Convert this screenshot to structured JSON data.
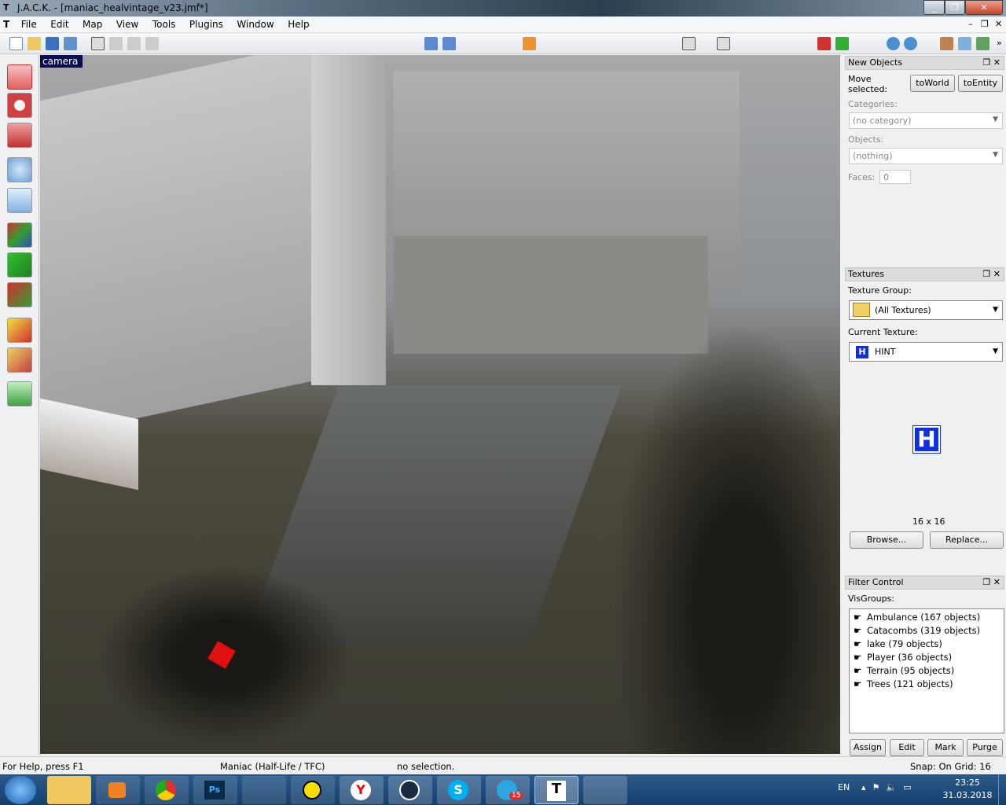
{
  "window": {
    "title": "J.A.C.K. - [maniac_healvintage_v23.jmf*]",
    "buttons": [
      "minimize",
      "maximize",
      "close"
    ]
  },
  "menu": [
    "File",
    "Edit",
    "Map",
    "View",
    "Tools",
    "Plugins",
    "Window",
    "Help"
  ],
  "viewport": {
    "label": "camera"
  },
  "left_tools": [
    "selection-tool",
    "magnify-tool",
    "camera-tool",
    "entity-tool",
    "block-tool",
    "texture-application-tool",
    "apply-current-texture",
    "apply-decals",
    "clipping-tool",
    "vertex-manipulation-tool",
    "path-tool"
  ],
  "new_objects": {
    "title": "New Objects",
    "move_label": "Move selected:",
    "to_world": "toWorld",
    "to_entity": "toEntity",
    "categories_label": "Categories:",
    "categories_value": "(no category)",
    "objects_label": "Objects:",
    "objects_value": "(nothing)",
    "faces_label": "Faces:",
    "faces_value": "0"
  },
  "textures": {
    "title": "Textures",
    "group_label": "Texture Group:",
    "group_value": "(All Textures)",
    "current_label": "Current Texture:",
    "current_value": "HINT",
    "preview_letter": "H",
    "size": "16 x 16",
    "browse": "Browse...",
    "replace": "Replace..."
  },
  "filter": {
    "title": "Filter Control",
    "visgroups_label": "VisGroups:",
    "groups": [
      "Ambulance (167 objects)",
      "Catacombs (319 objects)",
      "lake (79 objects)",
      "Player (36 objects)",
      "Terrain (95 objects)",
      "Trees (121 objects)"
    ],
    "assign": "Assign",
    "edit": "Edit",
    "mark": "Mark",
    "purge": "Purge"
  },
  "status": {
    "help": "For Help, press F1",
    "game": "Maniac (Half-Life / TFC)",
    "selection": "no selection.",
    "snap": "Snap: On Grid: 16"
  },
  "taskbar": {
    "apps": [
      "explorer",
      "media-player",
      "chrome",
      "photoshop",
      "gimp",
      "app",
      "yandex",
      "steam",
      "skype",
      "telegram",
      "jack",
      "paint"
    ],
    "telegram_badge": "15",
    "lang": "EN",
    "time": "23:25",
    "date": "31.03.2018"
  },
  "colors": {
    "hint_blue": "#1030e0",
    "viewport_label_bg": "#0a0a50"
  }
}
